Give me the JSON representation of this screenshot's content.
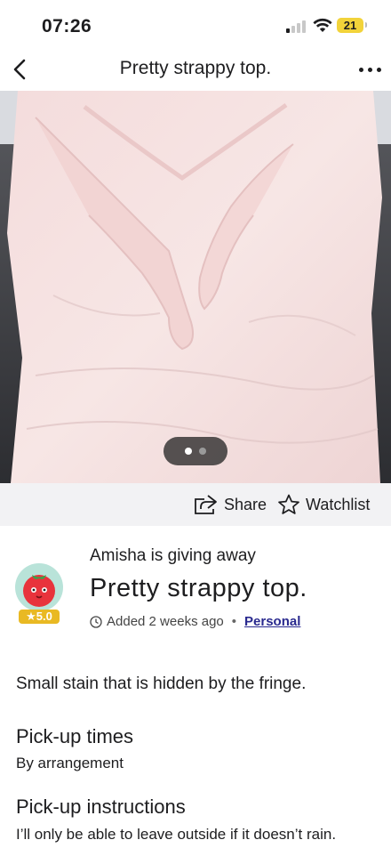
{
  "status": {
    "time": "07:26",
    "battery": "21"
  },
  "nav": {
    "title": "Pretty strappy top."
  },
  "photo": {
    "alt": "Pretty strappy top."
  },
  "actions": {
    "share": "Share",
    "watchlist": "Watchlist"
  },
  "listing": {
    "giver_line": "Amisha is giving away",
    "title": "Pretty strappy top.",
    "rating": "★5.0",
    "added": "Added 2 weeks ago",
    "category": "Personal",
    "description": "Small stain that is hidden by the fringe."
  },
  "pickup": {
    "times_heading": "Pick-up times",
    "times_value": "By arrangement",
    "instructions_heading": "Pick-up instructions",
    "instructions_value": "I’ll only be able to leave outside if it doesn’t rain."
  },
  "colors": {
    "link": "#2a2a8f",
    "rating_badge": "#e9b923",
    "action_row_bg": "#f2f2f4"
  }
}
